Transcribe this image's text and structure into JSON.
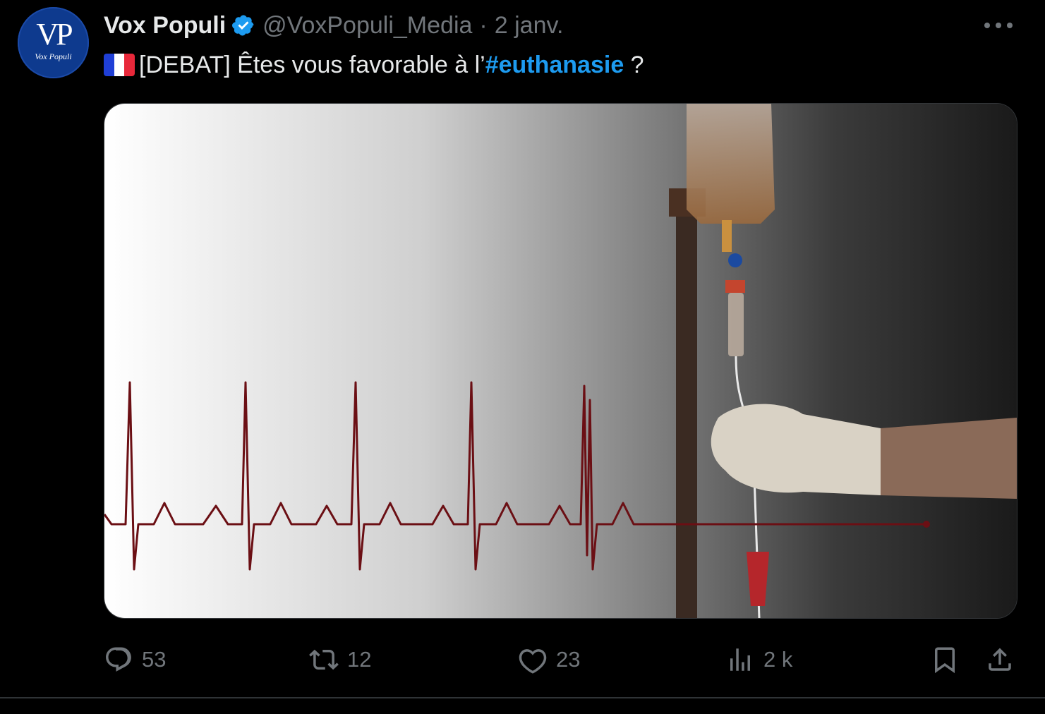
{
  "tweet": {
    "avatar": {
      "monogram": "VP",
      "caption": "Vox Populi"
    },
    "author_name": "Vox Populi",
    "verified_icon": "verified-badge-icon",
    "handle": "@VoxPopuli_Media",
    "separator": "·",
    "time": "2 janv.",
    "more_icon": "more-horizontal-icon",
    "text_prefix": "[DEBAT] Êtes vous favorable à l’",
    "hashtag": "#euthanasie",
    "text_suffix": " ?",
    "flag_icon": "france-flag-icon",
    "media": {
      "description_icon": "heartbeat-iv-drip-image"
    },
    "actions": {
      "replies": "53",
      "retweets": "12",
      "likes": "23",
      "views": "2 k",
      "reply_icon": "reply-icon",
      "retweet_icon": "retweet-icon",
      "like_icon": "heart-icon",
      "views_icon": "views-icon",
      "bookmark_icon": "bookmark-icon",
      "share_icon": "share-icon"
    },
    "colors": {
      "background": "#000000",
      "text": "#e7e9ea",
      "muted": "#71767b",
      "accent": "#1d9bf0",
      "ecg": "#6b0f14"
    }
  }
}
